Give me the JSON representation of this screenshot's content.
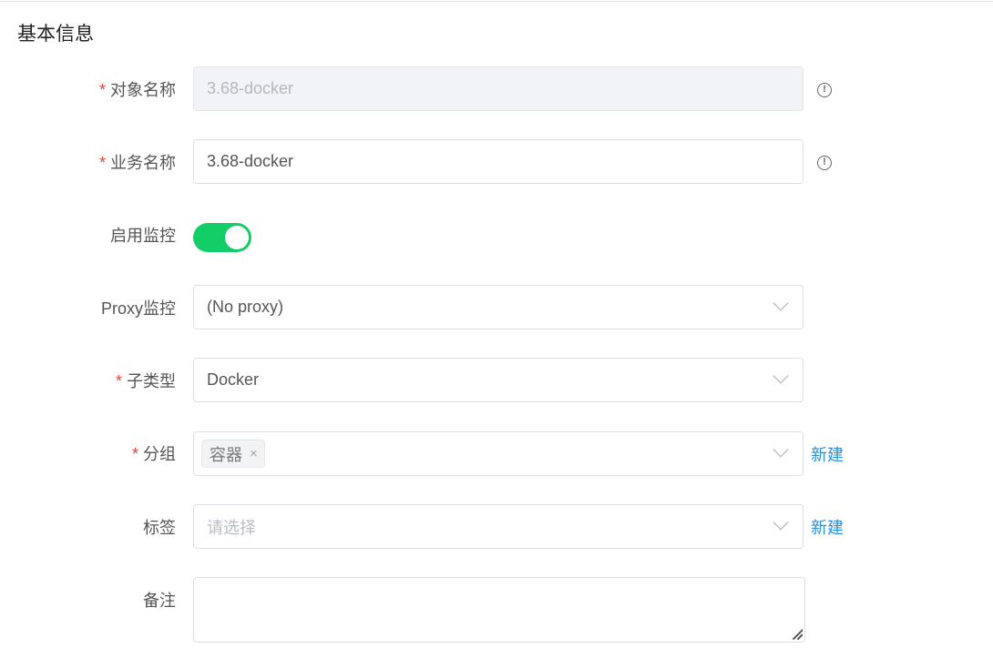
{
  "section": {
    "title": "基本信息"
  },
  "form": {
    "required_mark": "*",
    "object_name": {
      "label": "对象名称",
      "value": "3.68-docker",
      "info_icon": "info-circle-icon"
    },
    "business_name": {
      "label": "业务名称",
      "value": "3.68-docker",
      "info_icon": "info-circle-icon"
    },
    "enable_monitor": {
      "label": "启用监控",
      "state": "on",
      "color": "#13ce66"
    },
    "proxy": {
      "label": "Proxy监控",
      "value": "(No proxy)"
    },
    "subtype": {
      "label": "子类型",
      "value": "Docker"
    },
    "group": {
      "label": "分组",
      "tags": [
        "容器"
      ],
      "tag_close": "×",
      "new_link": "新建"
    },
    "tags": {
      "label": "标签",
      "placeholder": "请选择",
      "new_link": "新建"
    },
    "remark": {
      "label": "备注",
      "value": ""
    }
  },
  "colors": {
    "required": "#e0463c",
    "link": "#2c8fd4",
    "switch_on": "#13ce66"
  }
}
